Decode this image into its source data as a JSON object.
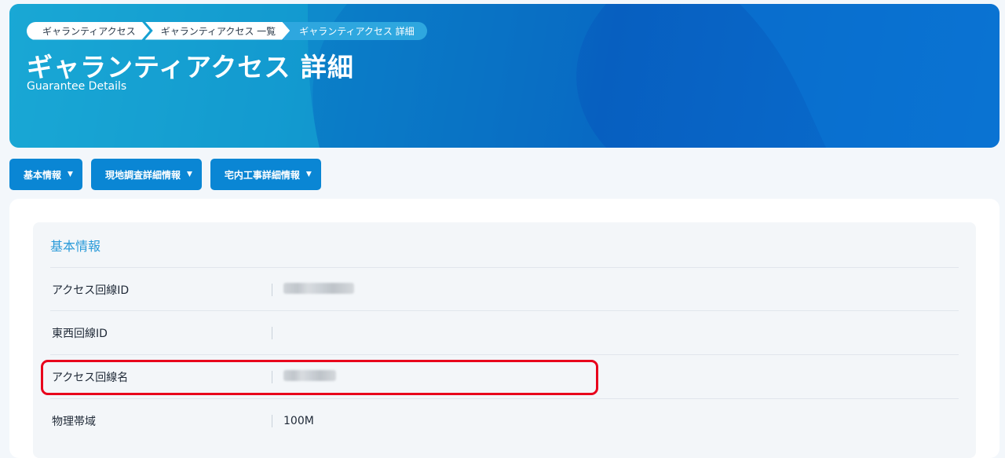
{
  "breadcrumb": {
    "items": [
      "ギャランティアクセス",
      "ギャランティアクセス 一覧",
      "ギャランティアクセス 詳細"
    ]
  },
  "header": {
    "title": "ギャランティアクセス 詳細",
    "subtitle": "Guarantee Details"
  },
  "tabs": [
    {
      "label": "基本情報"
    },
    {
      "label": "現地調査詳細情報"
    },
    {
      "label": "宅内工事詳細情報"
    }
  ],
  "section": {
    "title": "基本情報",
    "rows": [
      {
        "label": "アクセス回線ID",
        "value": "",
        "redacted": true
      },
      {
        "label": "東西回線ID",
        "value": ""
      },
      {
        "label": "アクセス回線名",
        "value": "",
        "redacted": true
      },
      {
        "label": "物理帯域",
        "value": "100M"
      }
    ]
  },
  "colors": {
    "accent": "#0a86d4",
    "section_title": "#2b9bd9",
    "highlight": "#e8001c"
  },
  "icons": {
    "dropdown": "caret-down-icon"
  }
}
